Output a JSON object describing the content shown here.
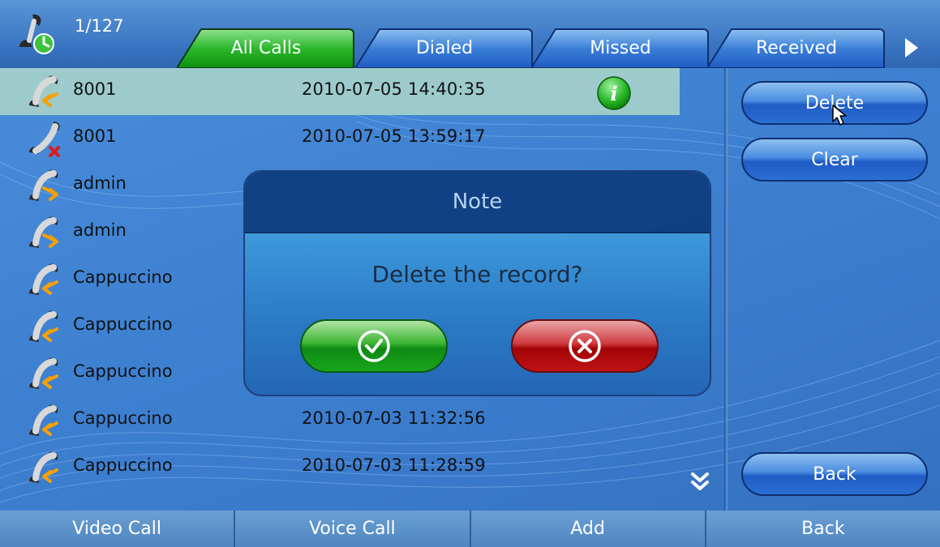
{
  "header": {
    "counter": "1/127",
    "tabs": [
      {
        "label": "All Calls",
        "active": true
      },
      {
        "label": "Dialed",
        "active": false
      },
      {
        "label": "Missed",
        "active": false
      },
      {
        "label": "Received",
        "active": false
      }
    ]
  },
  "calls": [
    {
      "name": "8001",
      "time": "2010-07-05 14:40:35",
      "type": "received",
      "icon": "incoming-call-icon"
    },
    {
      "name": "8001",
      "time": "2010-07-05 13:59:17",
      "type": "missed",
      "icon": "missed-call-icon"
    },
    {
      "name": "admin",
      "time": "",
      "type": "dialed",
      "icon": "outgoing-call-icon"
    },
    {
      "name": "admin",
      "time": "",
      "type": "dialed",
      "icon": "outgoing-call-icon"
    },
    {
      "name": "Cappuccino",
      "time": "",
      "type": "received",
      "icon": "incoming-call-icon"
    },
    {
      "name": "Cappuccino",
      "time": "",
      "type": "received",
      "icon": "incoming-call-icon"
    },
    {
      "name": "Cappuccino",
      "time": "",
      "type": "received",
      "icon": "incoming-call-icon"
    },
    {
      "name": "Cappuccino",
      "time": "2010-07-03 11:32:56",
      "type": "received",
      "icon": "incoming-call-icon"
    },
    {
      "name": "Cappuccino",
      "time": "2010-07-03 11:28:59",
      "type": "received",
      "icon": "incoming-call-icon"
    }
  ],
  "side_buttons": {
    "delete": "Delete",
    "clear": "Clear",
    "back": "Back"
  },
  "softkeys": [
    "Video Call",
    "Voice Call",
    "Add",
    "Back"
  ],
  "dialog": {
    "title": "Note",
    "message": "Delete the record?"
  },
  "colors": {
    "selected_row": "#9dcbcb",
    "active_tab": "#1fa51f",
    "tab": "#1f5cc4",
    "ok": "#18a818",
    "cancel": "#c41010",
    "incoming_arrow": "#f7a000",
    "missed_mark": "#e01818"
  }
}
